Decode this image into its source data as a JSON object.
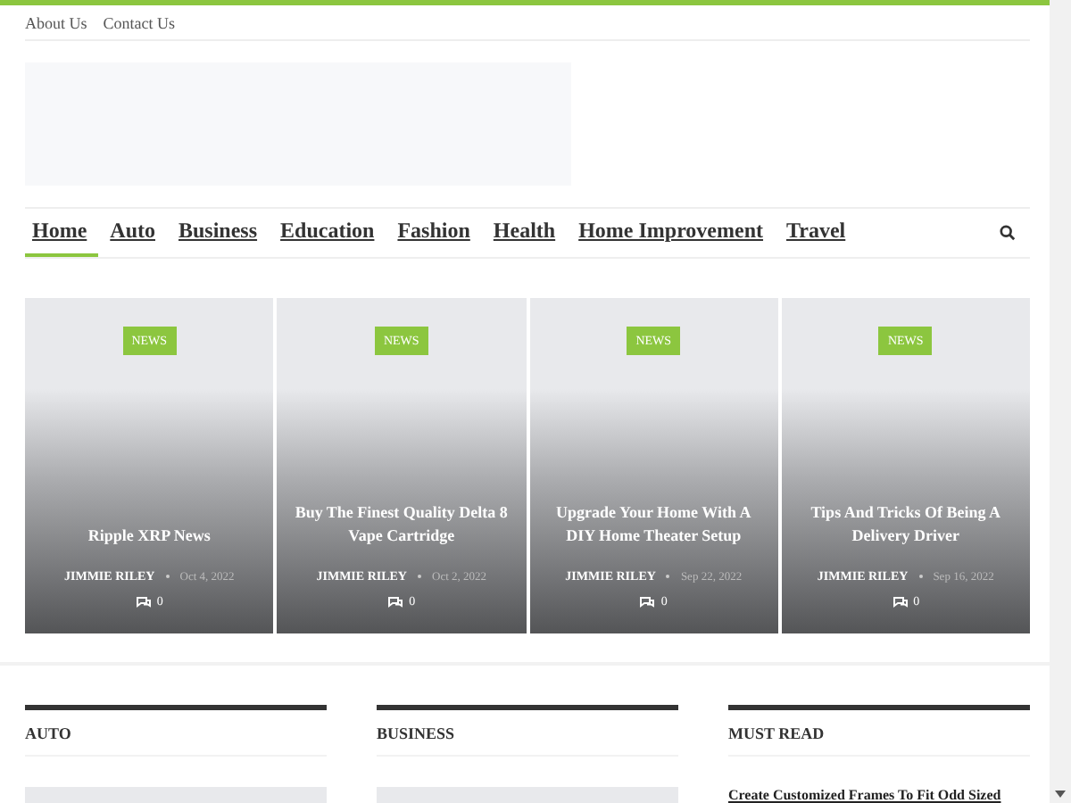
{
  "top_links": [
    "About Us",
    "Contact Us"
  ],
  "nav": {
    "items": [
      {
        "label": "Home",
        "selected": true
      },
      {
        "label": "Auto",
        "selected": false
      },
      {
        "label": "Business",
        "selected": false
      },
      {
        "label": "Education",
        "selected": false
      },
      {
        "label": "Fashion",
        "selected": false
      },
      {
        "label": "Health",
        "selected": false
      },
      {
        "label": "Home Improvement",
        "selected": false
      },
      {
        "label": "Travel",
        "selected": false
      }
    ]
  },
  "featured": [
    {
      "category": "NEWS",
      "title": "Ripple XRP News",
      "author": "JIMMIE RILEY",
      "date": "Oct 4, 2022",
      "comments": "0"
    },
    {
      "category": "NEWS",
      "title": "Buy The Finest Quality Delta 8 Vape Cartridge",
      "author": "JIMMIE RILEY",
      "date": "Oct 2, 2022",
      "comments": "0"
    },
    {
      "category": "NEWS",
      "title": "Upgrade Your Home With A DIY Home Theater Setup",
      "author": "JIMMIE RILEY",
      "date": "Sep 22, 2022",
      "comments": "0"
    },
    {
      "category": "NEWS",
      "title": "Tips And Tricks Of Being A Delivery Driver",
      "author": "JIMMIE RILEY",
      "date": "Sep 16, 2022",
      "comments": "0"
    }
  ],
  "sections": [
    {
      "heading": "AUTO",
      "kind": "posts"
    },
    {
      "heading": "BUSINESS",
      "kind": "posts"
    },
    {
      "heading": "MUST READ",
      "kind": "list",
      "items": [
        "Create Customized Frames To Fit Odd Sized"
      ]
    }
  ]
}
